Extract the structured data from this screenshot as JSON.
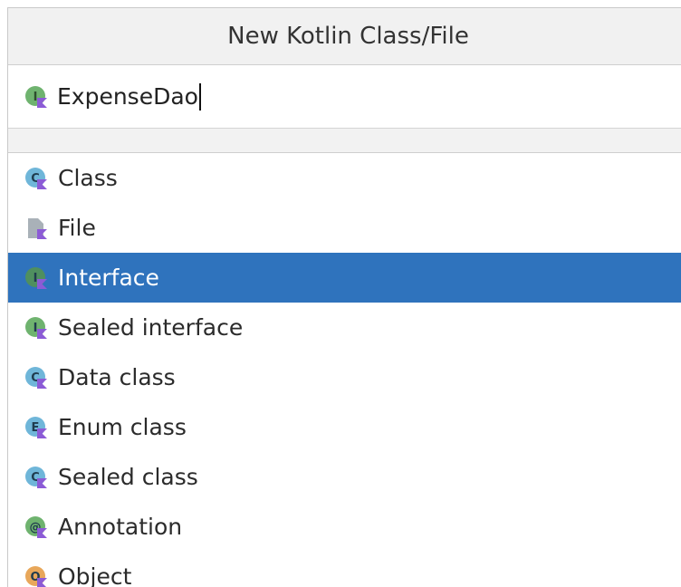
{
  "dialog": {
    "title": "New Kotlin Class/File",
    "name_value": "ExpenseDao",
    "name_icon": "interface-kotlin-icon"
  },
  "kinds": [
    {
      "label": "Class",
      "icon": "class-kotlin-icon",
      "letter": "C",
      "color": "#6fb6d9",
      "selected": false
    },
    {
      "label": "File",
      "icon": "file-kotlin-icon",
      "letter": "",
      "color": "#a9b1b8",
      "selected": false
    },
    {
      "label": "Interface",
      "icon": "interface-kotlin-icon",
      "letter": "I",
      "color": "#4f8f5f",
      "selected": true
    },
    {
      "label": "Sealed interface",
      "icon": "sealed-interface-kotlin-icon",
      "letter": "I",
      "color": "#6fb36f",
      "selected": false
    },
    {
      "label": "Data class",
      "icon": "data-class-kotlin-icon",
      "letter": "C",
      "color": "#6fb6d9",
      "selected": false
    },
    {
      "label": "Enum class",
      "icon": "enum-class-kotlin-icon",
      "letter": "E",
      "color": "#6fb6d9",
      "selected": false
    },
    {
      "label": "Sealed class",
      "icon": "sealed-class-kotlin-icon",
      "letter": "C",
      "color": "#6fb6d9",
      "selected": false
    },
    {
      "label": "Annotation",
      "icon": "annotation-kotlin-icon",
      "letter": "@",
      "color": "#6fb36f",
      "selected": false
    },
    {
      "label": "Object",
      "icon": "object-kotlin-icon",
      "letter": "O",
      "color": "#e8a75a",
      "selected": false
    }
  ]
}
